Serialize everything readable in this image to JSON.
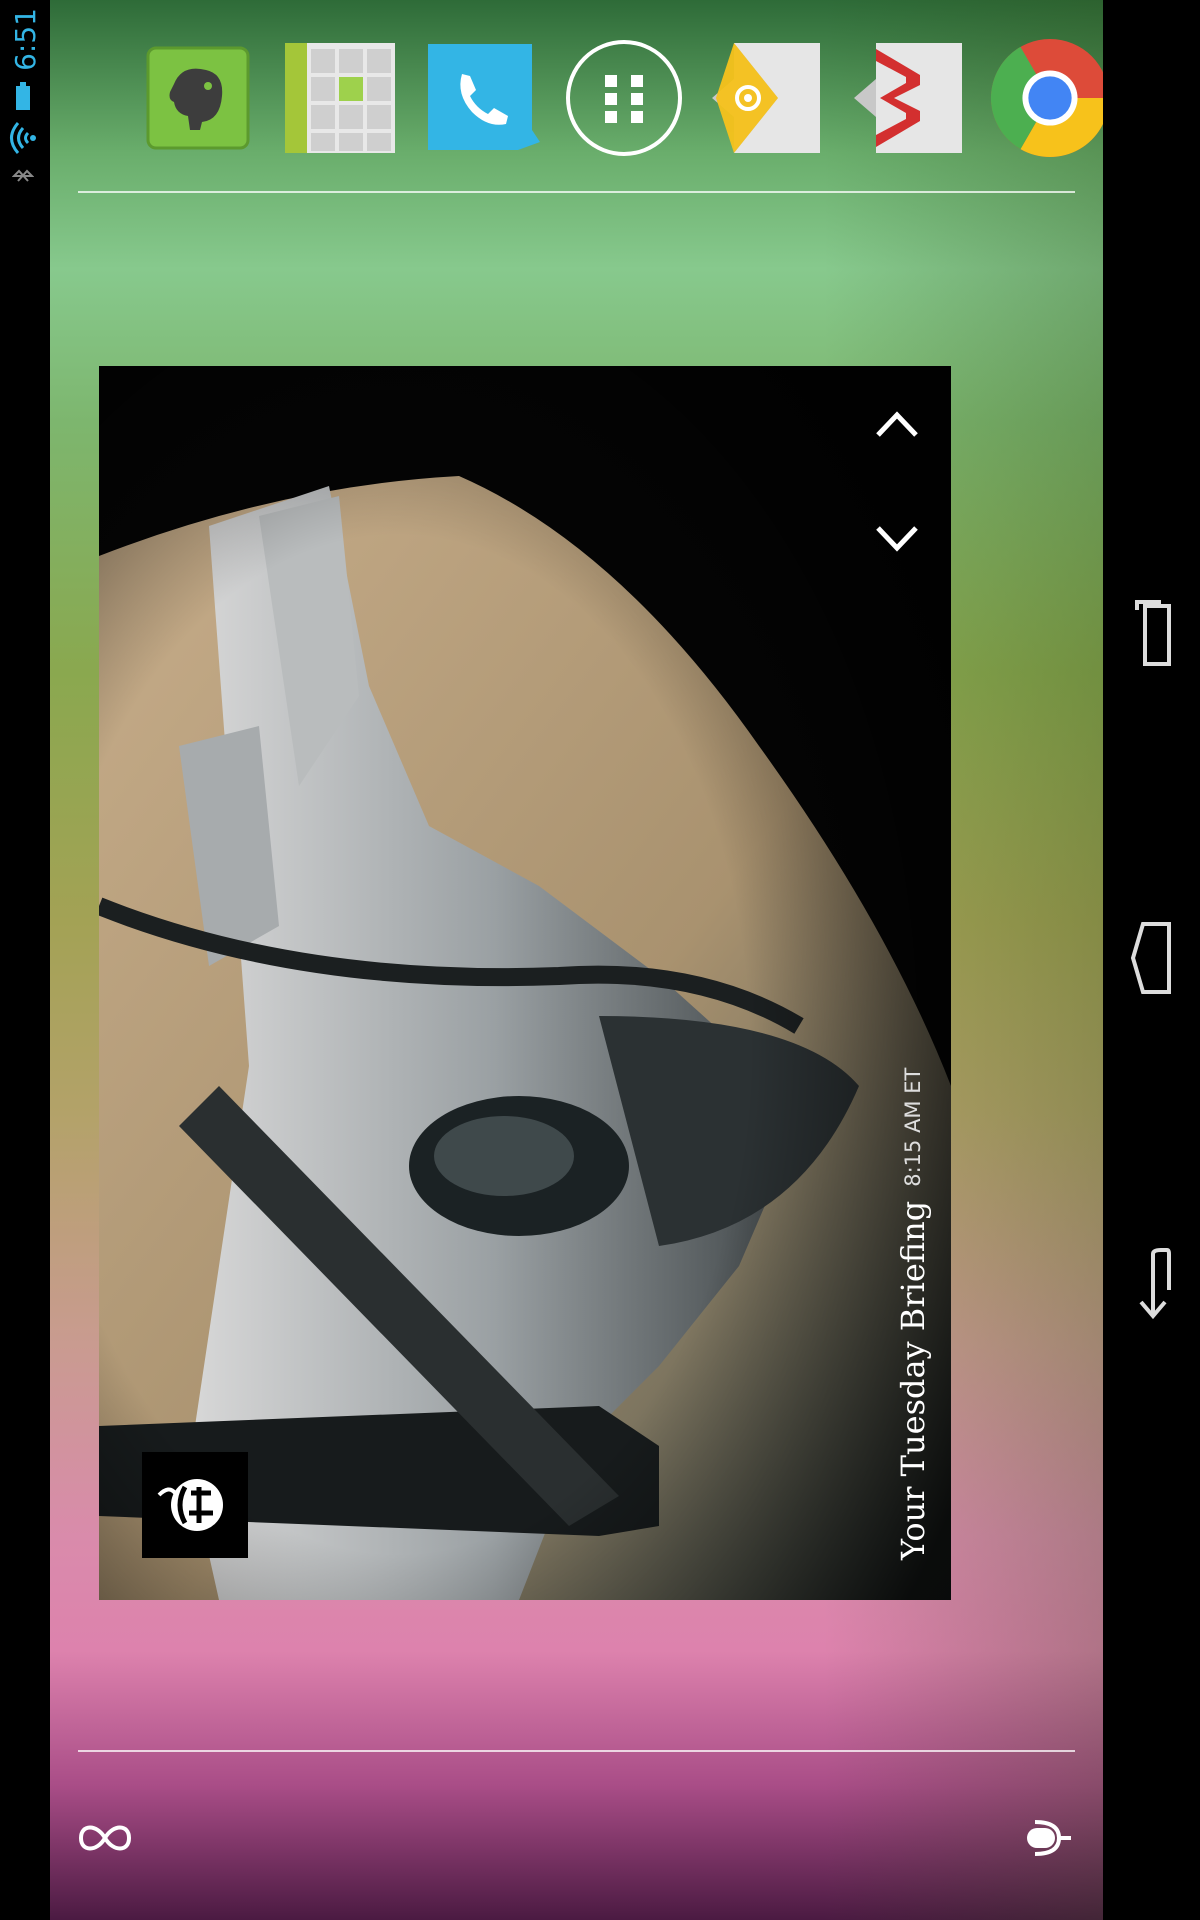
{
  "status_bar": {
    "time": "6:51",
    "icons": [
      "bluetooth-icon",
      "wifi-icon",
      "battery-icon"
    ],
    "time_color": "#33b5e5"
  },
  "dock": {
    "apps": [
      {
        "name": "Evernote",
        "icon": "evernote-icon"
      },
      {
        "name": "Launcher tiles",
        "icon": "tiles-app-icon"
      },
      {
        "name": "Phone",
        "icon": "phone-icon"
      },
      {
        "name": "All apps",
        "icon": "app-drawer-icon"
      },
      {
        "name": "Email",
        "icon": "email-icon"
      },
      {
        "name": "Gmail",
        "icon": "gmail-icon"
      },
      {
        "name": "Chrome",
        "icon": "chrome-icon"
      }
    ]
  },
  "widget": {
    "title": "Your Tuesday Briefing",
    "time": "8:15 AM ET",
    "source_logo": "nyt-logo-icon",
    "photo": "fighter-jet-refueling-photo"
  },
  "bottom": {
    "left_icon": "infinity-icon",
    "right_icon": "microphone-icon"
  },
  "nav": {
    "buttons": [
      "recent-apps-icon",
      "home-icon",
      "back-icon"
    ]
  }
}
